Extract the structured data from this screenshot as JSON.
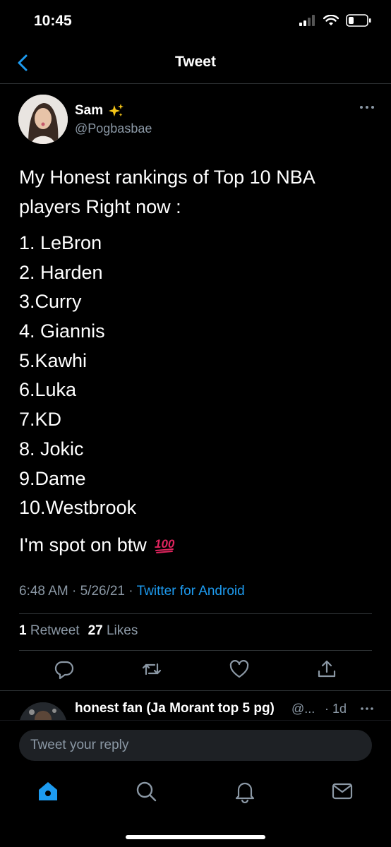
{
  "status_bar": {
    "time": "10:45"
  },
  "nav": {
    "title": "Tweet"
  },
  "author": {
    "name": "Sam",
    "name_emoji": "✨",
    "handle": "@Pogbasbae"
  },
  "tweet": {
    "intro": "My Honest rankings of Top 10 NBA players Right now :",
    "list": [
      "1. LeBron",
      "2. Harden",
      "3.Curry",
      "4. Giannis",
      "5.Kawhi",
      "6.Luka",
      "7.KD",
      "8. Jokic",
      "9.Dame",
      "10.Westbrook"
    ],
    "closing": "I'm spot on btw",
    "closing_emoji": "💯"
  },
  "meta": {
    "time": "6:48 AM",
    "date": "5/26/21",
    "source": "Twitter for Android"
  },
  "stats": {
    "retweets": "1",
    "retweets_label": "Retweet",
    "likes": "27",
    "likes_label": "Likes"
  },
  "actions": {
    "icons": [
      "reply-icon",
      "retweet-icon",
      "like-icon",
      "share-icon"
    ]
  },
  "reply_preview": {
    "name": "honest fan (Ja Morant top 5 pg)",
    "handle": "@...",
    "time": "· 1d"
  },
  "reply_bar": {
    "placeholder": "Tweet your reply"
  },
  "tabbar": {
    "icons": [
      "home-icon",
      "search-icon",
      "notifications-icon",
      "messages-icon"
    ]
  },
  "colors": {
    "accent": "#1d9bf0",
    "secondary_text": "#8b98a5",
    "divider": "#2f3336",
    "emoji_red": "#e0245e"
  }
}
